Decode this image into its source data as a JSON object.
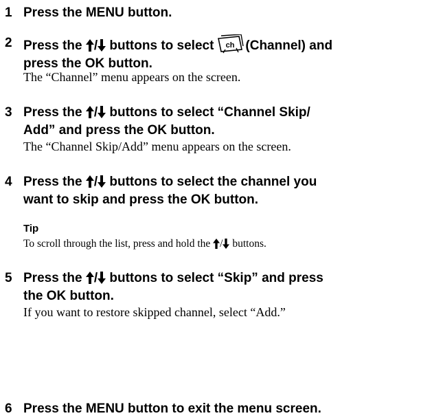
{
  "steps": [
    {
      "number": "1",
      "text": "Press the MENU button."
    },
    {
      "number": "2",
      "line1_a": "Press the",
      "line1_b": "buttons to select",
      "line1_c": "(Channel) and",
      "line2": "press the OK button.",
      "desc": "The “Channel” menu appears on the screen."
    },
    {
      "number": "3",
      "line1_a": "Press the",
      "line1_b": "buttons to select “Channel Skip/",
      "line2": "Add” and press the OK button.",
      "desc": "The “Channel Skip/Add” menu appears on the screen."
    },
    {
      "number": "4",
      "line1_a": "Press the",
      "line1_b": "buttons to select the channel you",
      "line2": "want to skip and press the OK button."
    },
    {
      "number": "5",
      "line1_a": "Press the",
      "line1_b": "buttons to select “Skip” and press",
      "line2": "the OK button.",
      "desc": "If you want to restore skipped channel, select “Add.”"
    },
    {
      "number": "6",
      "text": "Press the MENU button to exit the menu screen."
    }
  ],
  "tip": {
    "heading": "Tip",
    "text_a": "To scroll through the list, press and hold the",
    "text_b": "buttons."
  },
  "icons": [
    "up-arrow-icon",
    "down-arrow-icon",
    "channel-icon"
  ],
  "arrow_separator": "/",
  "channel_icon_label": "ch"
}
